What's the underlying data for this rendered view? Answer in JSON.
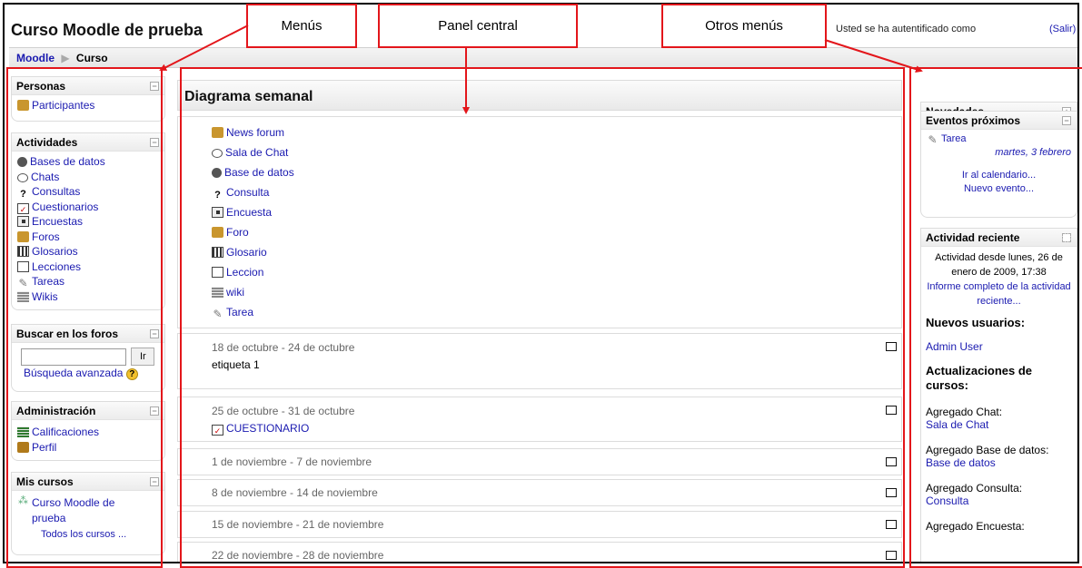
{
  "header": {
    "site_title": "Curso Moodle de prueba",
    "login_text": "Usted se ha autentificado como",
    "logout_label": "(Salir)"
  },
  "breadcrumb": {
    "home": "Moodle",
    "separator": "▶",
    "current": "Curso"
  },
  "left": {
    "personas": {
      "title": "Personas",
      "items": [
        "Participantes"
      ]
    },
    "actividades": {
      "title": "Actividades",
      "items": [
        "Bases de datos",
        "Chats",
        "Consultas",
        "Cuestionarios",
        "Encuestas",
        "Foros",
        "Glosarios",
        "Lecciones",
        "Tareas",
        "Wikis"
      ]
    },
    "buscar": {
      "title": "Buscar en los foros",
      "button": "Ir",
      "search_value": "",
      "advanced": "Búsqueda avanzada",
      "help_icon": "?"
    },
    "admin": {
      "title": "Administración",
      "items": [
        "Calificaciones",
        "Perfil"
      ]
    },
    "cursos": {
      "title": "Mis cursos",
      "items": [
        "Curso Moodle de prueba"
      ],
      "all": "Todos los cursos ..."
    }
  },
  "center": {
    "title": "Diagrama semanal",
    "activities": [
      "News forum",
      "Sala de Chat",
      "Base de datos",
      "Consulta",
      "Encuesta",
      "Foro",
      "Glosario",
      "Leccion",
      "wiki",
      "Tarea"
    ],
    "weeks": [
      {
        "date": "18 de octubre - 24 de octubre",
        "content": "etiqueta 1"
      },
      {
        "date": "25 de octubre - 31 de octubre",
        "content": "CUESTIONARIO"
      },
      {
        "date": "1 de noviembre - 7 de noviembre"
      },
      {
        "date": "8 de noviembre - 14 de noviembre"
      },
      {
        "date": "15 de noviembre - 21 de noviembre"
      },
      {
        "date": "22 de noviembre - 28 de noviembre"
      }
    ]
  },
  "right": {
    "novedades": {
      "title": "Novedades",
      "toggle": "+"
    },
    "eventos": {
      "title": "Eventos próximos",
      "event_name": "Tarea",
      "event_date": "martes, 3 febrero",
      "calendar_link": "Ir al calendario...",
      "new_event_link": "Nuevo evento..."
    },
    "actividad": {
      "title": "Actividad reciente",
      "since": "Actividad desde lunes, 26 de enero de 2009, 17:38",
      "report_link": "Informe completo de la actividad reciente...",
      "new_users_heading": "Nuevos usuarios:",
      "new_user": "Admin User",
      "updates_heading": "Actualizaciones de cursos:",
      "updates": [
        {
          "label": "Agregado Chat:",
          "link": "Sala de Chat"
        },
        {
          "label": "Agregado Base de datos:",
          "link": "Base de datos"
        },
        {
          "label": "Agregado Consulta:",
          "link": "Consulta"
        },
        {
          "label": "Agregado Encuesta:",
          "link": ""
        }
      ]
    }
  },
  "annotations": {
    "menus": "Menús",
    "panel_central": "Panel central",
    "otros_menus": "Otros menús"
  },
  "colors": {
    "annotation": "#e3161b",
    "link": "#1a1ab0"
  }
}
